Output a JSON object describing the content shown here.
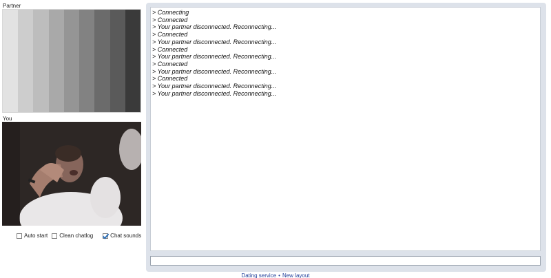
{
  "partner": {
    "label": "Partner",
    "test_pattern_colors": [
      "#e2e2e2",
      "#cdcdcd",
      "#bdbdbd",
      "#a9a9a9",
      "#959595",
      "#828282",
      "#6b6b6b",
      "#5a5a5a",
      "#3a3a3a"
    ]
  },
  "you": {
    "label": "You"
  },
  "options": [
    {
      "label": "Auto start",
      "checked": false
    },
    {
      "label": "Clean chatlog",
      "checked": false
    },
    {
      "label": "Chat sounds",
      "checked": true
    }
  ],
  "chat": {
    "log": [
      "> Connecting",
      "> Connected",
      "> Your partner disconnected. Reconnecting...",
      "> Connected",
      "> Your partner disconnected. Reconnecting...",
      "> Connected",
      "> Your partner disconnected. Reconnecting...",
      "> Connected",
      "> Your partner disconnected. Reconnecting...",
      "> Connected",
      "> Your partner disconnected. Reconnecting...",
      "> Your partner disconnected. Reconnecting..."
    ],
    "input_value": ""
  },
  "footer": {
    "link1": "Dating service",
    "separator": "•",
    "link2": "New layout"
  },
  "colors": {
    "panel_bg": "#dde2ea",
    "link": "#1f3f9a",
    "checkbox_accent": "#2a6fb8"
  }
}
